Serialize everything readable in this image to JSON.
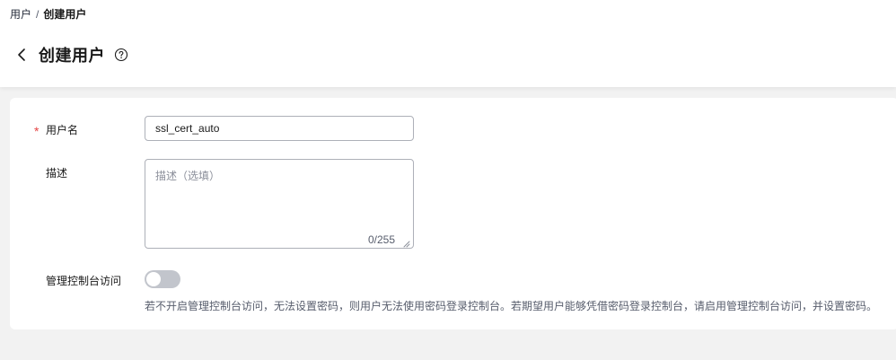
{
  "breadcrumb": {
    "parent": "用户",
    "separator": "/",
    "current": "创建用户"
  },
  "page": {
    "title": "创建用户",
    "back_icon": "chevron-left-icon",
    "help_icon": "question-circle-icon"
  },
  "form": {
    "username": {
      "label": "用户名",
      "required_mark": "*",
      "value": "ssl_cert_auto"
    },
    "description": {
      "label": "描述",
      "placeholder": "描述（选填）",
      "char_count": "0/255"
    },
    "console_access": {
      "label": "管理控制台访问",
      "enabled": false,
      "hint": "若不开启管理控制台访问，无法设置密码，则用户无法使用密码登录控制台。若期望用户能够凭借密码登录控制台，请启用管理控制台访问，并设置密码。"
    }
  },
  "colors": {
    "required": "#e54545",
    "input_border": "#adb0b8",
    "toggle_off": "#c2c5cc",
    "page_bg": "#f2f2f2",
    "hint_text": "#575d6c"
  }
}
